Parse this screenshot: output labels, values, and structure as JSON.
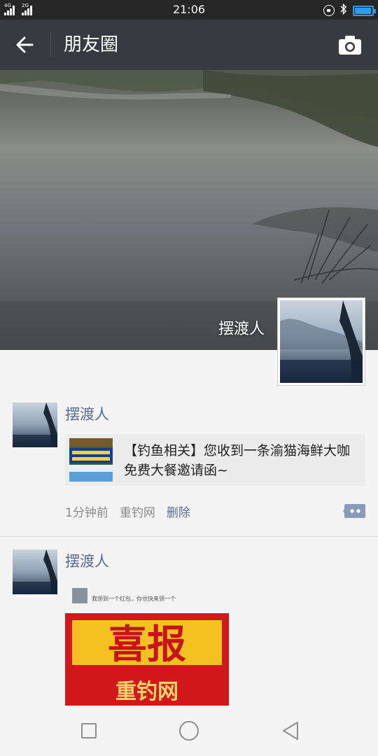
{
  "status_bar": {
    "time": "21:06",
    "network_1": "4G",
    "network_2": "2G",
    "battery_level": 0.95,
    "icons": [
      "signal-icon",
      "rotation-lock-icon",
      "bluetooth-icon",
      "battery-icon"
    ]
  },
  "header": {
    "title": "朋友圈",
    "back_icon": "arrow-left-icon",
    "camera_icon": "camera-icon"
  },
  "cover": {
    "user_name": "摆渡人"
  },
  "posts": [
    {
      "user": "摆渡人",
      "share_text": "【钓鱼相关】您收到一条渝猫海鲜大咖免费大餐邀请函~",
      "time": "1分钟前",
      "source": "重钓网",
      "delete_label": "删除"
    },
    {
      "user": "摆渡人",
      "image_caption_small": "我领到一个红包，你也快来领一个",
      "image_headline": "喜报",
      "image_subline": "重钓网"
    }
  ],
  "colors": {
    "title_bar": "#393a3f",
    "status_bar": "#262626",
    "link_blue": "#576b95",
    "page_bg": "#f4f4f4"
  }
}
